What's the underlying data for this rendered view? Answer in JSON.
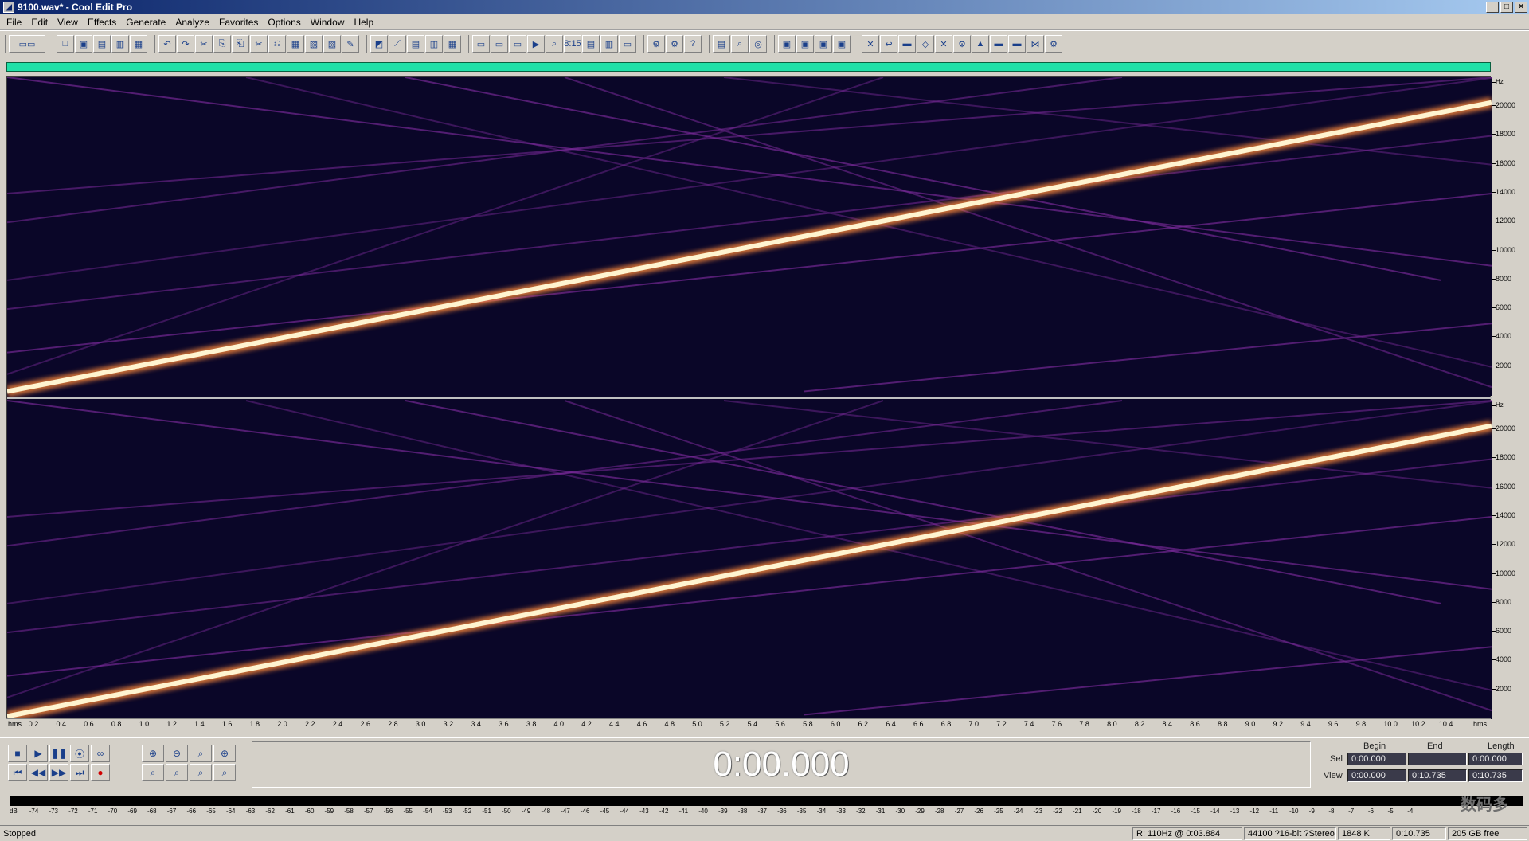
{
  "window": {
    "title": "9100.wav* - Cool Edit Pro",
    "min_glyph": "_",
    "max_glyph": "□",
    "close_glyph": "×"
  },
  "menu": [
    "File",
    "Edit",
    "View",
    "Effects",
    "Generate",
    "Analyze",
    "Favorites",
    "Options",
    "Window",
    "Help"
  ],
  "toolbar": {
    "groups": [
      [
        "▭▭"
      ],
      [
        "□",
        "▣",
        "▤",
        "▥",
        "▦"
      ],
      [
        "↶",
        "↷",
        "✂",
        "⎘",
        "⎗",
        "✂",
        "⎌",
        "▦",
        "▧",
        "▨",
        "✎"
      ],
      [
        "◩",
        "⟋",
        "▤",
        "▥",
        "▦"
      ],
      [
        "▭",
        "▭",
        "▭",
        "▶",
        "⌕",
        "8:15",
        "▤",
        "▥",
        "▭"
      ],
      [
        "⚙",
        "⚙",
        "?"
      ],
      [
        "▤",
        "⌕",
        "◎"
      ],
      [
        "▣",
        "▣",
        "▣",
        "▣"
      ],
      [
        "✕",
        "↩",
        "▬",
        "◇",
        "✕",
        "⚙",
        "▲",
        "▬",
        "▬",
        "⋈",
        "⚙"
      ]
    ]
  },
  "spectral": {
    "freq_unit": "Hz",
    "freq_labels": [
      "20000",
      "18000",
      "16000",
      "14000",
      "12000",
      "10000",
      "8000",
      "6000",
      "4000",
      "2000"
    ],
    "sweep_color": "#fff4d0",
    "glow_color": "#ff8a3a",
    "alias_color": "#7a2a9a",
    "background_color": "#0a0628"
  },
  "time_ruler": {
    "unit": "hms",
    "labels": [
      "0.2",
      "0.4",
      "0.6",
      "0.8",
      "1.0",
      "1.2",
      "1.4",
      "1.6",
      "1.8",
      "2.0",
      "2.2",
      "2.4",
      "2.6",
      "2.8",
      "3.0",
      "3.2",
      "3.4",
      "3.6",
      "3.8",
      "4.0",
      "4.2",
      "4.4",
      "4.6",
      "4.8",
      "5.0",
      "5.2",
      "5.4",
      "5.6",
      "5.8",
      "6.0",
      "6.2",
      "6.4",
      "6.6",
      "6.8",
      "7.0",
      "7.2",
      "7.4",
      "7.6",
      "7.8",
      "8.0",
      "8.2",
      "8.4",
      "8.6",
      "8.8",
      "9.0",
      "9.2",
      "9.4",
      "9.6",
      "9.8",
      "10.0",
      "10.2",
      "10.4"
    ]
  },
  "transport": {
    "row1": [
      "■",
      "▶",
      "❚❚",
      "⦿",
      "∞"
    ],
    "row2": [
      "⏮",
      "◀◀",
      "▶▶",
      "⏭",
      "●"
    ]
  },
  "zoom": {
    "row1": [
      "⊕",
      "⊖",
      "⌕",
      "⊕"
    ],
    "row2": [
      "⌕",
      "⌕",
      "⌕",
      "⌕"
    ]
  },
  "time_display": "0:00.000",
  "selview": {
    "headers": [
      "Begin",
      "End",
      "Length"
    ],
    "sel_label": "Sel",
    "view_label": "View",
    "sel": [
      "0:00.000",
      "",
      "0:00.000"
    ],
    "view": [
      "0:00.000",
      "0:10.735",
      "0:10.735"
    ]
  },
  "meter": {
    "labels": [
      "dB",
      "-74",
      "-73",
      "-72",
      "-71",
      "-70",
      "-69",
      "-68",
      "-67",
      "-66",
      "-65",
      "-64",
      "-63",
      "-62",
      "-61",
      "-60",
      "-59",
      "-58",
      "-57",
      "-56",
      "-55",
      "-54",
      "-53",
      "-52",
      "-51",
      "-50",
      "-49",
      "-48",
      "-47",
      "-46",
      "-45",
      "-44",
      "-43",
      "-42",
      "-41",
      "-40",
      "-39",
      "-38",
      "-37",
      "-36",
      "-35",
      "-34",
      "-33",
      "-32",
      "-31",
      "-30",
      "-29",
      "-28",
      "-27",
      "-26",
      "-25",
      "-24",
      "-23",
      "-22",
      "-21",
      "-20",
      "-19",
      "-18",
      "-17",
      "-16",
      "-15",
      "-14",
      "-13",
      "-12",
      "-11",
      "-10",
      "-9",
      "-8",
      "-7",
      "-6",
      "-5",
      "-4"
    ]
  },
  "status": {
    "left": "Stopped",
    "cursor": "R: 110Hz @ 0:03.884",
    "format": "44100 ?16-bit ?Stereo",
    "size": "1848 K",
    "duration": "0:10.735",
    "free": "205 GB free"
  },
  "watermark": "数码多"
}
